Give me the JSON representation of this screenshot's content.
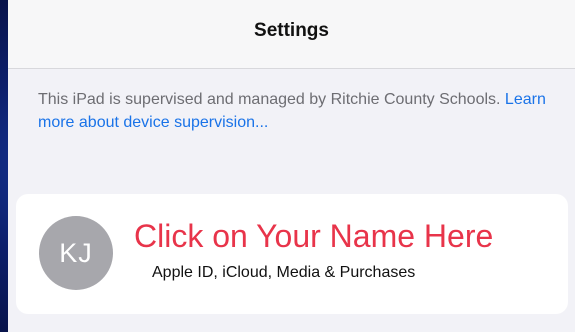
{
  "nav": {
    "title": "Settings"
  },
  "supervision": {
    "text": "This iPad is supervised and managed by Ritchie County Schools. ",
    "link": "Learn more about device supervision..."
  },
  "profile": {
    "initials": "KJ",
    "annotation": "Click on Your Name Here",
    "subtitle": "Apple ID, iCloud, Media & Purchases"
  },
  "colors": {
    "link": "#1a73e8",
    "annotation": "#e8344a",
    "avatar": "#a7a7ac",
    "background": "#f2f2f7"
  }
}
